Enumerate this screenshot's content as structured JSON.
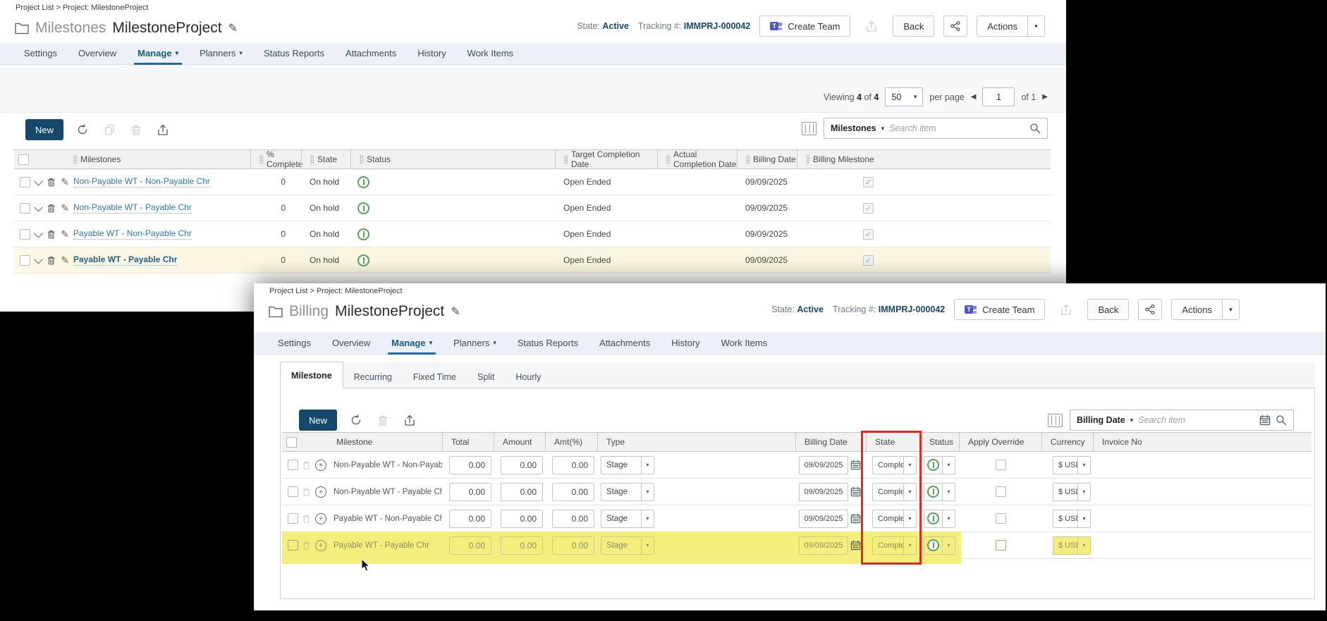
{
  "icons": {
    "pencil": "✎",
    "caret_down": "▾",
    "check": "✓",
    "prev_arrow": "◀",
    "next_arrow": "▶",
    "plus": "+",
    "teams_t": "T"
  },
  "colors": {
    "accent_navy": "#16466e",
    "tab_active": "#175a86",
    "tab_underline": "#1b6ba6",
    "new_button": "#14496b",
    "link_blue": "#2e79ae",
    "status_green": "#57a15d",
    "highlight_pale_yellow": "#fcf8e3",
    "highlight_bright_yellow": "#f4ef7c",
    "annotation_red": "#e8281e"
  },
  "top_window": {
    "breadcrumb": "Project List > Project: MilestoneProject",
    "title": {
      "section": "Milestones",
      "project": "MilestoneProject"
    },
    "header": {
      "state_label": "State:",
      "state": "Active",
      "tracking_label": "Tracking #:",
      "tracking": "IMMPRJ-000042",
      "create_team": "Create Team",
      "back": "Back",
      "actions": "Actions"
    },
    "tabs": {
      "settings": "Settings",
      "overview": "Overview",
      "manage": "Manage",
      "planners": "Planners",
      "status_reports": "Status Reports",
      "attachments": "Attachments",
      "history": "History",
      "work_items": "Work Items"
    },
    "paging": {
      "viewing": "Viewing",
      "current": "4",
      "of": "of",
      "total": "4",
      "size": "50",
      "per_page": "per page",
      "page": "1",
      "pages": "of 1"
    },
    "toolbar": {
      "new": "New"
    },
    "search": {
      "filter": "Milestones",
      "placeholder": "Search item"
    },
    "table": {
      "headers": {
        "milestones": "Milestones",
        "pct": "% Complete",
        "state": "State",
        "status": "Status",
        "target": "Target Completion Date",
        "actual": "Actual Completion Date",
        "billing_date": "Billing Date",
        "billing_milestone": "Billing Milestone"
      },
      "rows": [
        {
          "name": "Non-Payable WT - Non-Payable Chr",
          "pct": "0",
          "state": "On hold",
          "target": "Open Ended",
          "billing_date": "09/09/2025"
        },
        {
          "name": "Non-Payable WT - Payable Chr",
          "pct": "0",
          "state": "On hold",
          "target": "Open Ended",
          "billing_date": "09/09/2025"
        },
        {
          "name": "Payable WT - Non-Payable Chr",
          "pct": "0",
          "state": "On hold",
          "target": "Open Ended",
          "billing_date": "09/09/2025"
        },
        {
          "name": "Payable WT - Payable Chr",
          "pct": "0",
          "state": "On hold",
          "target": "Open Ended",
          "billing_date": "09/09/2025"
        }
      ]
    }
  },
  "bottom_window": {
    "breadcrumb": "Project List > Project: MilestoneProject",
    "title": {
      "section": "Billing",
      "project": "MilestoneProject"
    },
    "header": {
      "state_label": "State:",
      "state": "Active",
      "tracking_label": "Tracking #:",
      "tracking": "IMMPRJ-000042",
      "create_team": "Create Team",
      "back": "Back",
      "actions": "Actions"
    },
    "tabs": {
      "settings": "Settings",
      "overview": "Overview",
      "manage": "Manage",
      "planners": "Planners",
      "status_reports": "Status Reports",
      "attachments": "Attachments",
      "history": "History",
      "work_items": "Work Items"
    },
    "subtabs": {
      "milestone": "Milestone",
      "recurring": "Recurring",
      "fixed_time": "Fixed Time",
      "split": "Split",
      "hourly": "Hourly"
    },
    "toolbar": {
      "new": "New"
    },
    "search": {
      "filter": "Billing Date",
      "placeholder": "Search item"
    },
    "table": {
      "headers": {
        "milestone": "Milestone",
        "total": "Total",
        "amount": "Amount",
        "amt_pct": "Amt(%)",
        "type": "Type",
        "billing_date": "Billing Date",
        "state": "State",
        "status": "Status",
        "apply_override": "Apply Override",
        "currency": "Currency",
        "invoice_no": "Invoice No"
      },
      "rows": [
        {
          "name": "Non-Payable WT - Non-Payable Chr",
          "total": "0.00",
          "amount": "0.00",
          "amt_pct": "0.00",
          "type": "Stage",
          "billing_date": "09/09/2025",
          "state": "Comple...",
          "currency": "$ USD"
        },
        {
          "name": "Non-Payable WT - Payable Chr",
          "total": "0.00",
          "amount": "0.00",
          "amt_pct": "0.00",
          "type": "Stage",
          "billing_date": "09/09/2025",
          "state": "Comple...",
          "currency": "$ USD"
        },
        {
          "name": "Payable WT - Non-Payable Chr",
          "total": "0.00",
          "amount": "0.00",
          "amt_pct": "0.00",
          "type": "Stage",
          "billing_date": "09/09/2025",
          "state": "Comple...",
          "currency": "$ USD"
        },
        {
          "name": "Payable WT - Payable Chr",
          "total": "0.00",
          "amount": "0.00",
          "amt_pct": "0.00",
          "type": "Stage",
          "billing_date": "09/09/2025",
          "state": "Comple...",
          "currency": "$ USD"
        }
      ]
    }
  }
}
